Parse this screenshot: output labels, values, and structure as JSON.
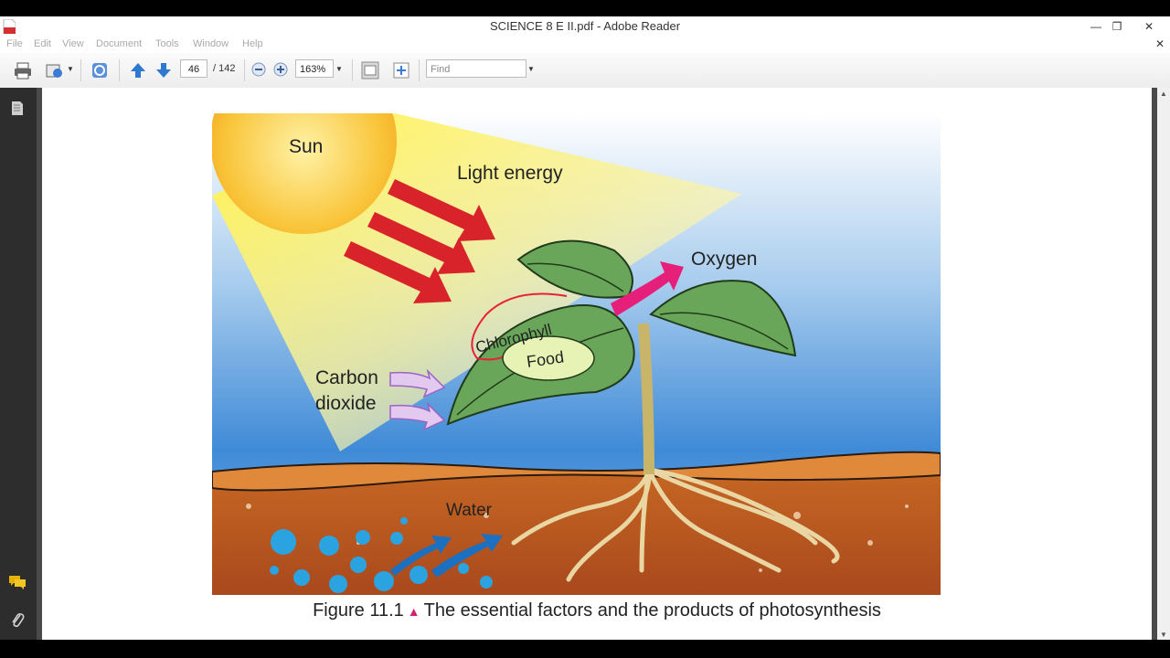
{
  "window": {
    "title": "SCIENCE 8 E II.pdf - Adobe Reader"
  },
  "menu": [
    "File",
    "Edit",
    "View",
    "Document",
    "Tools",
    "Window",
    "Help"
  ],
  "toolbar": {
    "page_current": "46",
    "page_total": "/ 142",
    "zoom": "163%",
    "find_placeholder": "Find"
  },
  "figure": {
    "labels": {
      "sun": "Sun",
      "light": "Light energy",
      "oxygen": "Oxygen",
      "chlorophyll": "Chlorophyll",
      "food": "Food",
      "co2_line1": "Carbon",
      "co2_line2": "dioxide",
      "water": "Water"
    },
    "caption_prefix": "Figure 11.1",
    "caption_text": "The essential factors and the products of photosynthesis"
  },
  "colors": {
    "sun": "#f7b829",
    "arrow_light": "#d8232a",
    "oxygen_arrow": "#e6207a",
    "co2_arrow": "#b98bd1",
    "leaf": "#6aa65a",
    "soil": "#b3521d",
    "water": "#2aa3e0"
  }
}
